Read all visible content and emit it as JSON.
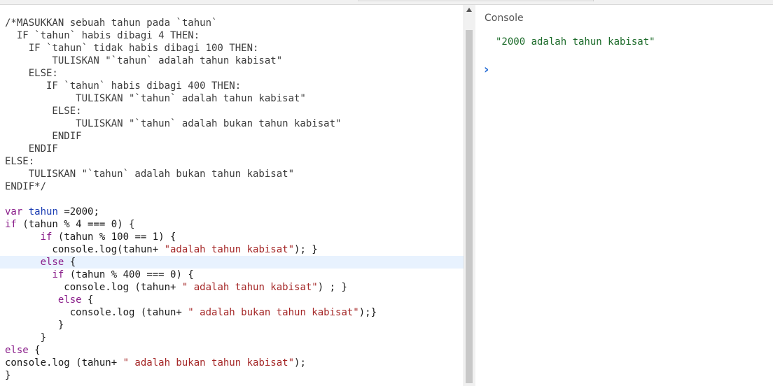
{
  "editor": {
    "lines": [
      [
        {
          "t": "/*MASUKKAN sebuah tahun pada `tahun`",
          "c": "comment"
        }
      ],
      [
        {
          "t": "  IF `tahun` habis dibagi 4 THEN:",
          "c": "comment"
        }
      ],
      [
        {
          "t": "    IF `tahun` tidak habis dibagi 100 THEN:",
          "c": "comment"
        }
      ],
      [
        {
          "t": "        TULISKAN \"`tahun` adalah tahun kabisat\"",
          "c": "comment"
        }
      ],
      [
        {
          "t": "    ELSE:",
          "c": "comment"
        }
      ],
      [
        {
          "t": "       IF `tahun` habis dibagi 400 THEN:",
          "c": "comment"
        }
      ],
      [
        {
          "t": "            TULISKAN \"`tahun` adalah tahun kabisat\"",
          "c": "comment"
        }
      ],
      [
        {
          "t": "        ELSE:",
          "c": "comment"
        }
      ],
      [
        {
          "t": "            TULISKAN \"`tahun` adalah bukan tahun kabisat\"",
          "c": "comment"
        }
      ],
      [
        {
          "t": "        ENDIF",
          "c": "comment"
        }
      ],
      [
        {
          "t": "    ENDIF",
          "c": "comment"
        }
      ],
      [
        {
          "t": "ELSE:",
          "c": "comment"
        }
      ],
      [
        {
          "t": "    TULISKAN \"`tahun` adalah bukan tahun kabisat\"",
          "c": "comment"
        }
      ],
      [
        {
          "t": "ENDIF*/",
          "c": "comment"
        }
      ],
      [],
      [
        {
          "t": "var",
          "c": "keyword"
        },
        {
          "t": " ",
          "c": "plain"
        },
        {
          "t": "tahun",
          "c": "def"
        },
        {
          "t": " =",
          "c": "plain"
        },
        {
          "t": "2000",
          "c": "number"
        },
        {
          "t": ";",
          "c": "plain"
        }
      ],
      [
        {
          "t": "if",
          "c": "keyword"
        },
        {
          "t": " (tahun % ",
          "c": "plain"
        },
        {
          "t": "4",
          "c": "number"
        },
        {
          "t": " === ",
          "c": "plain"
        },
        {
          "t": "0",
          "c": "number"
        },
        {
          "t": ") {",
          "c": "plain"
        }
      ],
      [
        {
          "t": "      ",
          "c": "plain"
        },
        {
          "t": "if",
          "c": "keyword"
        },
        {
          "t": " (tahun % ",
          "c": "plain"
        },
        {
          "t": "100",
          "c": "number"
        },
        {
          "t": " == ",
          "c": "plain"
        },
        {
          "t": "1",
          "c": "number"
        },
        {
          "t": ") {",
          "c": "plain"
        }
      ],
      [
        {
          "t": "        console.log(tahun+ ",
          "c": "plain"
        },
        {
          "t": "\"adalah tahun kabisat\"",
          "c": "string"
        },
        {
          "t": "); }",
          "c": "plain"
        }
      ],
      [
        {
          "t": "      ",
          "c": "plain"
        },
        {
          "t": "else",
          "c": "keyword"
        },
        {
          "t": " {",
          "c": "plain"
        }
      ],
      [
        {
          "t": "        ",
          "c": "plain"
        },
        {
          "t": "if",
          "c": "keyword"
        },
        {
          "t": " (tahun % ",
          "c": "plain"
        },
        {
          "t": "400",
          "c": "number"
        },
        {
          "t": " === ",
          "c": "plain"
        },
        {
          "t": "0",
          "c": "number"
        },
        {
          "t": ") {",
          "c": "plain"
        }
      ],
      [
        {
          "t": "          console.log (tahun+ ",
          "c": "plain"
        },
        {
          "t": "\" adalah tahun kabisat\"",
          "c": "string"
        },
        {
          "t": ") ; }",
          "c": "plain"
        }
      ],
      [
        {
          "t": "         ",
          "c": "plain"
        },
        {
          "t": "else",
          "c": "keyword"
        },
        {
          "t": " {",
          "c": "plain"
        }
      ],
      [
        {
          "t": "           console.log (tahun+ ",
          "c": "plain"
        },
        {
          "t": "\" adalah bukan tahun kabisat\"",
          "c": "string"
        },
        {
          "t": ");}",
          "c": "plain"
        }
      ],
      [
        {
          "t": "         }",
          "c": "plain"
        }
      ],
      [
        {
          "t": "      }",
          "c": "plain"
        }
      ],
      [
        {
          "t": "else",
          "c": "keyword"
        },
        {
          "t": " {",
          "c": "plain"
        }
      ],
      [
        {
          "t": "console.log (tahun+ ",
          "c": "plain"
        },
        {
          "t": "\" adalah bukan tahun kabisat\"",
          "c": "string"
        },
        {
          "t": ");",
          "c": "plain"
        }
      ],
      [
        {
          "t": "}",
          "c": "plain"
        }
      ]
    ],
    "active_line": 19
  },
  "console": {
    "title": "Console",
    "output": "\"2000 adalah tahun kabisat\"",
    "prompt": "›",
    "prompt_icon": "chevron-right-icon"
  },
  "colors": {
    "keyword": "#8a1e8a",
    "def": "#1a3cb3",
    "string": "#a52828",
    "console_output": "#1c6b2a",
    "prompt": "#2a6fd6",
    "active_line_bg": "#e8f2fe"
  }
}
